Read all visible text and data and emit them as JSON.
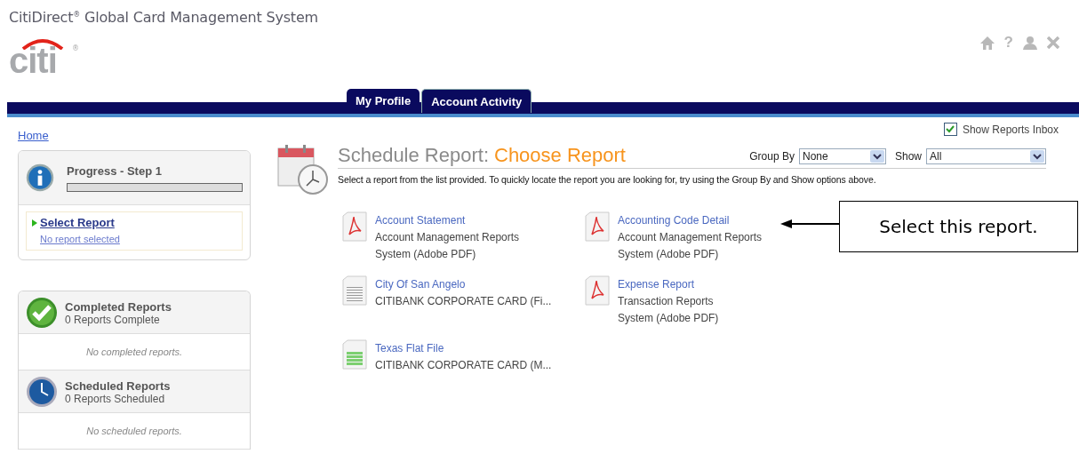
{
  "header": {
    "title": "CitiDirect$^{®}$ Global Card Management System",
    "logo": "citi",
    "logo_mark": "®",
    "help": "?"
  },
  "tabs": [
    {
      "label": "My Profile",
      "selected": false
    },
    {
      "label": "Account Activity",
      "selected": true
    }
  ],
  "breadcrumb": "Home",
  "show_reports_inbox": {
    "label": "Show Reports Inbox",
    "checked": true
  },
  "progress": {
    "title": "Progress - Step 1",
    "level": 0,
    "step": "Select Report",
    "status": "No report selected"
  },
  "completed": {
    "title": "Completed Reports",
    "count": "0 Reports Complete",
    "empty": "No completed reports."
  },
  "scheduled": {
    "title": "Scheduled Reports",
    "count": "0 Reports Scheduled",
    "empty": "No scheduled reports."
  },
  "main": {
    "title": "Schedule Report:",
    "subtitle": "Choose Report",
    "group_by": {
      "label": "Group By",
      "value": "None"
    },
    "show": {
      "label": "Show",
      "value": "All"
    },
    "instructions": "Select a report from the list provided. To quickly locate the report you are looking for, try using the Group By and Show options above."
  },
  "reports": [
    {
      "kind": "pdf",
      "name": "Account Statement",
      "lines": [
        "Account Management Reports",
        "System (Adobe PDF)"
      ]
    },
    {
      "kind": "pdf",
      "name": "Accounting Code Detail",
      "lines": [
        "Account Management Reports",
        "System (Adobe PDF)"
      ]
    },
    {
      "kind": "text",
      "name": "City Of San Angelo",
      "lines": [
        "CITIBANK CORPORATE CARD (Fi..."
      ]
    },
    {
      "kind": "pdf",
      "name": "Expense Report",
      "lines": [
        "Transaction Reports",
        "System (Adobe PDF)"
      ]
    },
    {
      "kind": "sheet",
      "name": "Texas Flat File",
      "lines": [
        "CITIBANK CORPORATE CARD (M..."
      ]
    }
  ],
  "callout": {
    "text": "Select this report."
  }
}
